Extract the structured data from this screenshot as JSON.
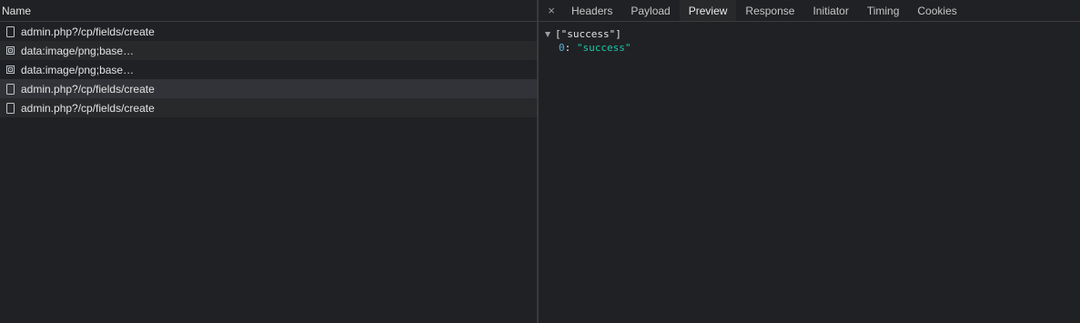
{
  "request_list": {
    "header": "Name",
    "rows": [
      {
        "name": "admin.php?/cp/fields/create",
        "icon": "document-icon"
      },
      {
        "name": "data:image/png;base…",
        "icon": "image-icon"
      },
      {
        "name": "data:image/png;base…",
        "icon": "image-icon"
      },
      {
        "name": "admin.php?/cp/fields/create",
        "icon": "document-icon"
      },
      {
        "name": "admin.php?/cp/fields/create",
        "icon": "document-icon"
      }
    ]
  },
  "details": {
    "close_glyph": "×",
    "tabs": [
      "Headers",
      "Payload",
      "Preview",
      "Response",
      "Initiator",
      "Timing",
      "Cookies"
    ],
    "active_tab": "Preview"
  },
  "preview": {
    "summary": "[\"success\"]",
    "items": [
      {
        "key": "0",
        "value": "\"success\""
      }
    ]
  },
  "colors": {
    "background": "#202124",
    "selected_row": "#323338",
    "active_tab": "#28292b",
    "json_key": "#5db0d7",
    "json_string": "#1cc7a7"
  }
}
